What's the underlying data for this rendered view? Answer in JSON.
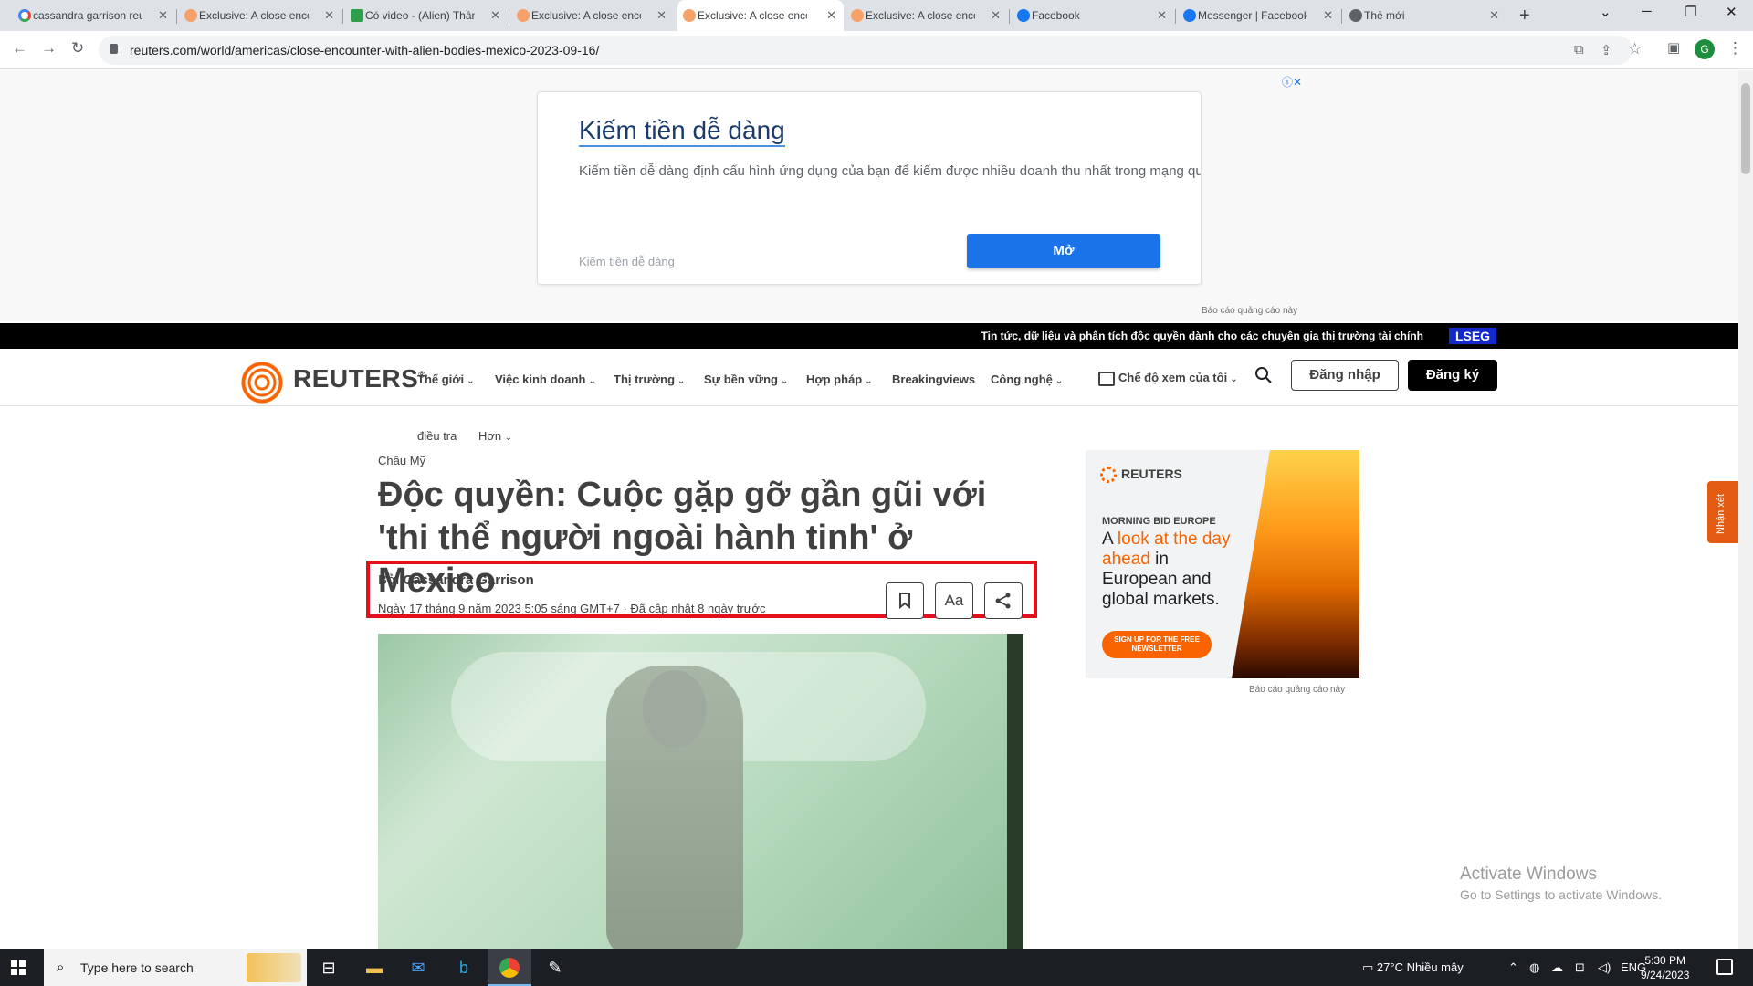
{
  "browser": {
    "tabs": [
      {
        "title": "cassandra garrison reu",
        "favicon": "google-icon",
        "active": false
      },
      {
        "title": "Exclusive: A close enco",
        "favicon": "reuters-icon",
        "active": false
      },
      {
        "title": "Có video - (Alien) Thần",
        "favicon": "check-icon",
        "active": false
      },
      {
        "title": "Exclusive: A close enco",
        "favicon": "reuters-icon",
        "active": false
      },
      {
        "title": "Exclusive: A close enco",
        "favicon": "reuters-icon",
        "active": true
      },
      {
        "title": "Exclusive: A close enco",
        "favicon": "reuters-icon",
        "active": false
      },
      {
        "title": "Facebook",
        "favicon": "facebook-icon",
        "active": false
      },
      {
        "title": "Messenger | Facebook",
        "favicon": "facebook-icon",
        "active": false
      },
      {
        "title": "Thẻ mới",
        "favicon": "chrome-icon",
        "active": false
      }
    ],
    "url": "reuters.com/world/americas/close-encounter-with-alien-bodies-mexico-2023-09-16/",
    "profile_initial": "G"
  },
  "top_ad": {
    "title": "Kiếm tiền dễ dàng",
    "description": "Kiếm tiền dễ dàng định cấu hình ứng dụng của bạn để kiếm được nhiều doanh thu nhất trong mạng quảng c",
    "brand": "Kiếm tiền dễ dàng",
    "button": "Mở",
    "report": "Báo cáo quảng cáo này"
  },
  "lseg_bar": {
    "text": "Tin tức, dữ liệu và phân tích độc quyền dành cho các chuyên gia thị trường tài chính",
    "logo": "LSEG"
  },
  "nav": {
    "logo": "REUTERS",
    "items": [
      "Thế giới",
      "Việc kinh doanh",
      "Thị trường",
      "Sự bền vững",
      "Hợp pháp",
      "Breakingviews",
      "Công nghệ"
    ],
    "my_view": "Chế độ xem của tôi",
    "login": "Đăng nhập",
    "register": "Đăng ký",
    "sub_items": [
      "điều tra",
      "Hơn"
    ]
  },
  "article": {
    "section": "Châu Mỹ",
    "headline": "Độc quyền: Cuộc gặp gỡ gần gũi với 'thi thể người ngoài hành tinh' ở Mexico",
    "by_prefix": "Bởi",
    "author": "Cassandra Garrison",
    "dateline": "Ngày 17 tháng 9 năm 2023 5:05 sáng GMT+7 · Đã cập nhật 8 ngày trước",
    "text_size_label": "Aa"
  },
  "rail_ad": {
    "brand": "REUTERS",
    "eyebrow": "MORNING BID EUROPE",
    "head_a": "A ",
    "head_highlight": "look at the day ahead",
    "head_b": " in European and global markets.",
    "cta": "SIGN UP FOR THE FREE NEWSLETTER",
    "report": "Báo cáo quảng cáo này"
  },
  "side_tab": "Nhận xét",
  "watermark": {
    "line1": "Activate Windows",
    "line2": "Go to Settings to activate Windows."
  },
  "taskbar": {
    "search_placeholder": "Type here to search",
    "weather": "27°C  Nhiều mây",
    "lang": "ENG",
    "time": "5:30 PM",
    "date": "9/24/2023"
  },
  "colors": {
    "reuters_orange": "#fa6400",
    "highlight_red": "#e3101b",
    "lseg_blue": "#1429c9"
  }
}
